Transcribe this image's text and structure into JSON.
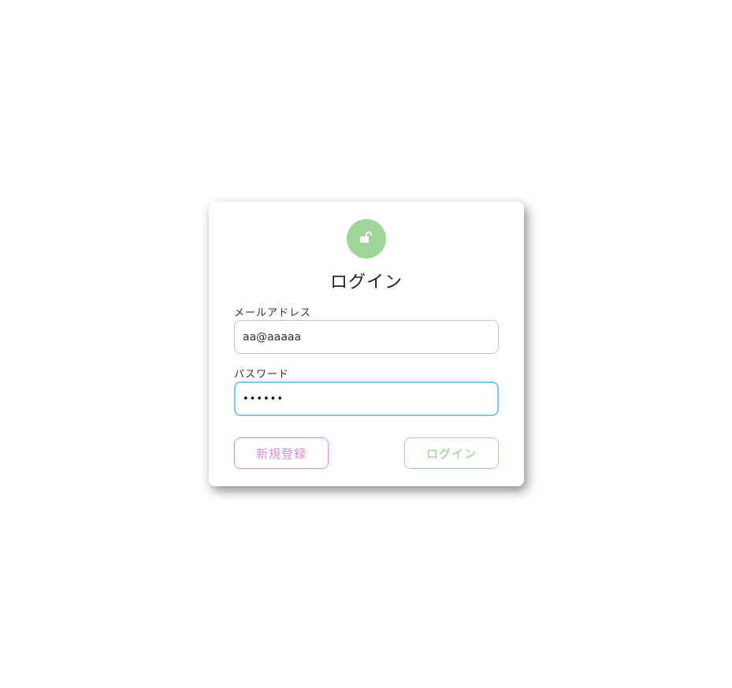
{
  "login_card": {
    "icon": "lock-open-icon",
    "title": "ログイン",
    "email": {
      "label": "メールアドレス",
      "value": "aa@aaaaa"
    },
    "password": {
      "label": "パスワード",
      "value": "••••••"
    },
    "register_button": "新規登録",
    "login_button": "ログイン"
  },
  "colors": {
    "avatar_bg": "#9fd49a",
    "register_accent": "#dd88dd",
    "login_accent": "#a6d6a3",
    "focus_border": "#7ec8e3"
  }
}
